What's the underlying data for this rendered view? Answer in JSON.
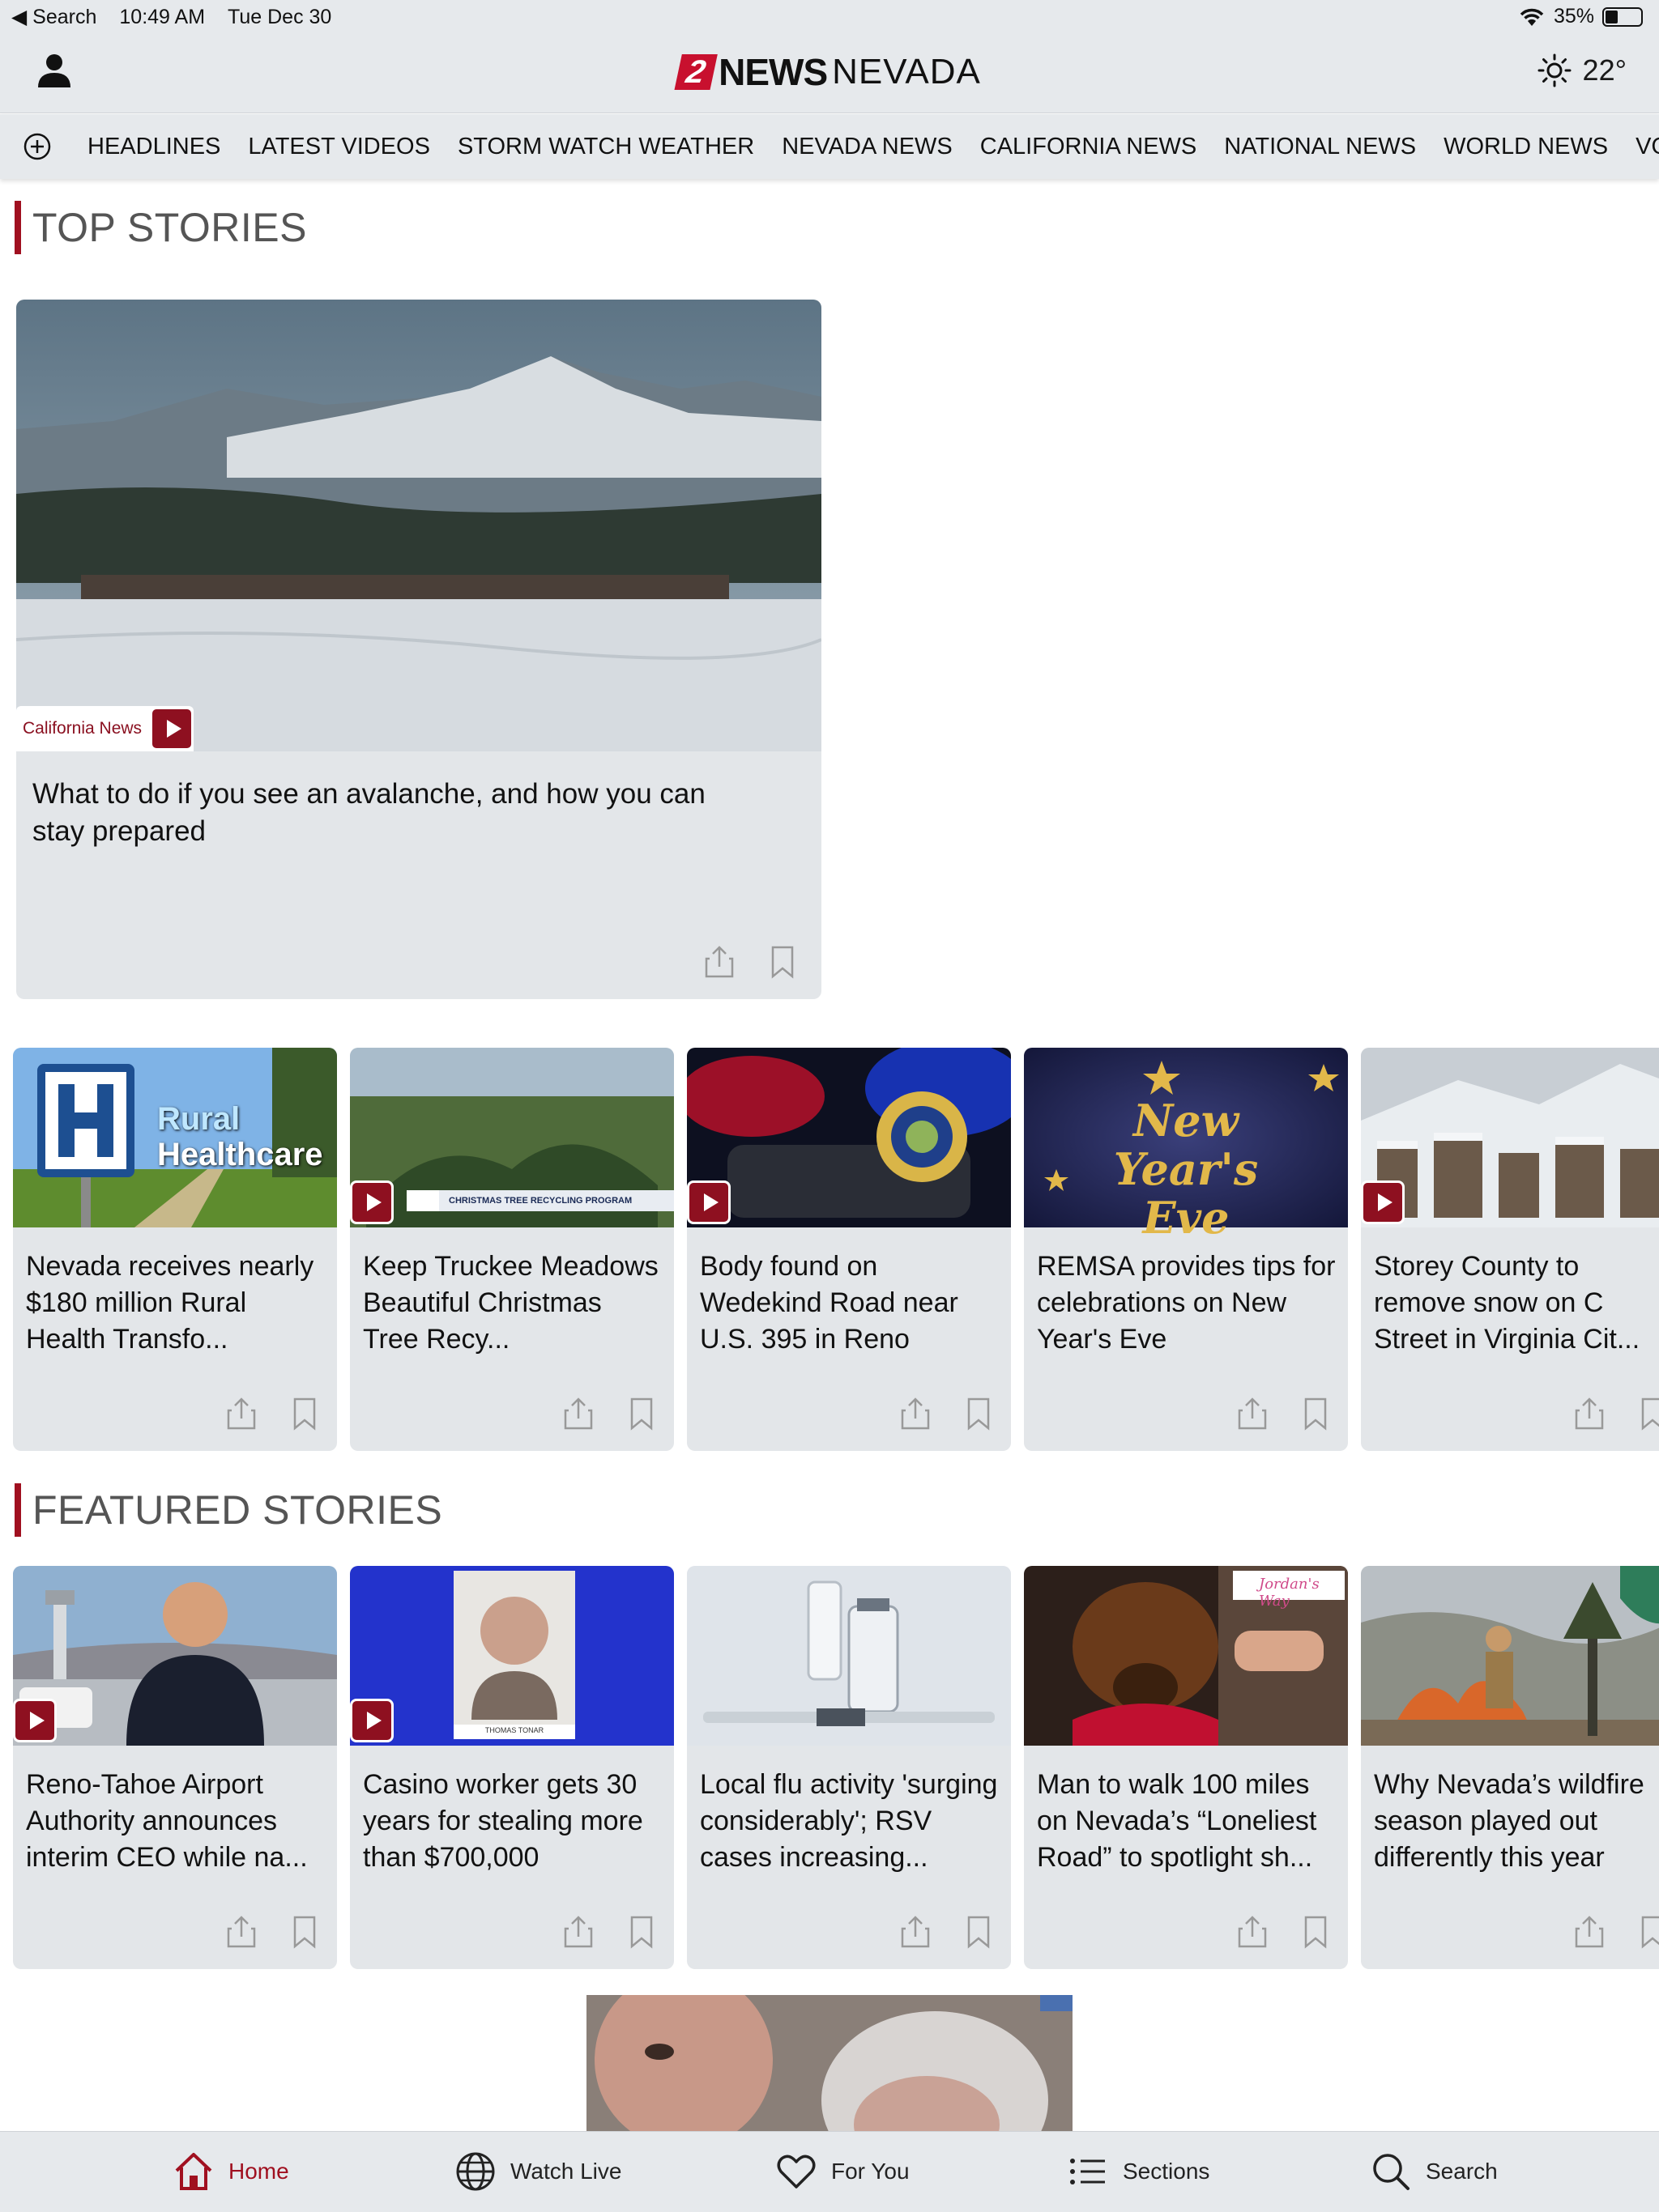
{
  "status": {
    "back_label": "◀ Search",
    "time": "10:49 AM",
    "date": "Tue Dec 30",
    "battery": "35%",
    "battery_level": 0.35
  },
  "header": {
    "logo_number": "2",
    "logo_news": "NEWS",
    "logo_nevada": "NEVADA",
    "temperature": "22°"
  },
  "nav": {
    "items": [
      "HEADLINES",
      "LATEST VIDEOS",
      "STORM WATCH WEATHER",
      "NEVADA NEWS",
      "CALIFORNIA NEWS",
      "NATIONAL NEWS",
      "WORLD NEWS",
      "VOT"
    ]
  },
  "top_stories": {
    "section_title": "TOP STORIES",
    "hero": {
      "category": "California News",
      "title": "What to do if you see an avalanche, and how you can stay prepared"
    },
    "cards": [
      {
        "title": "Nevada receives nearly $180 million Rural Health Transfo...",
        "image_text_1": "Rural",
        "image_text_2": "Healthcare"
      },
      {
        "title": "Keep Truckee Meadows Beautiful Christmas Tree Recy...",
        "image_text": "CHRISTMAS TREE RECYCLING PROGRAM"
      },
      {
        "title": "Body found on Wedekind Road near U.S. 395 in Reno"
      },
      {
        "title": "REMSA provides tips for celebrations on New Year's Eve",
        "image_text": "New Year's Eve"
      },
      {
        "title": "Storey County to remove snow on C Street in Virginia Cit..."
      }
    ]
  },
  "featured_stories": {
    "section_title": "FEATURED STORIES",
    "cards": [
      {
        "title": "Reno-Tahoe Airport Authority announces interim CEO while na..."
      },
      {
        "title": "Casino worker gets 30 years for stealing more than $700,000",
        "image_text": "THOMAS TONAR"
      },
      {
        "title": "Local flu activity 'surging considerably'; RSV cases increasing..."
      },
      {
        "title": "Man to walk 100 miles on Nevada’s “Loneliest Road” to spotlight sh...",
        "image_text": "Jordan's Way"
      },
      {
        "title": "Why Nevada’s wildfire season played out differently this year"
      }
    ]
  },
  "tabbar": {
    "items": [
      "Home",
      "Watch Live",
      "For You",
      "Sections",
      "Search"
    ]
  },
  "colors": {
    "accent": "#a01020",
    "background": "#e6e9ec",
    "card": "#e3e6e9"
  }
}
